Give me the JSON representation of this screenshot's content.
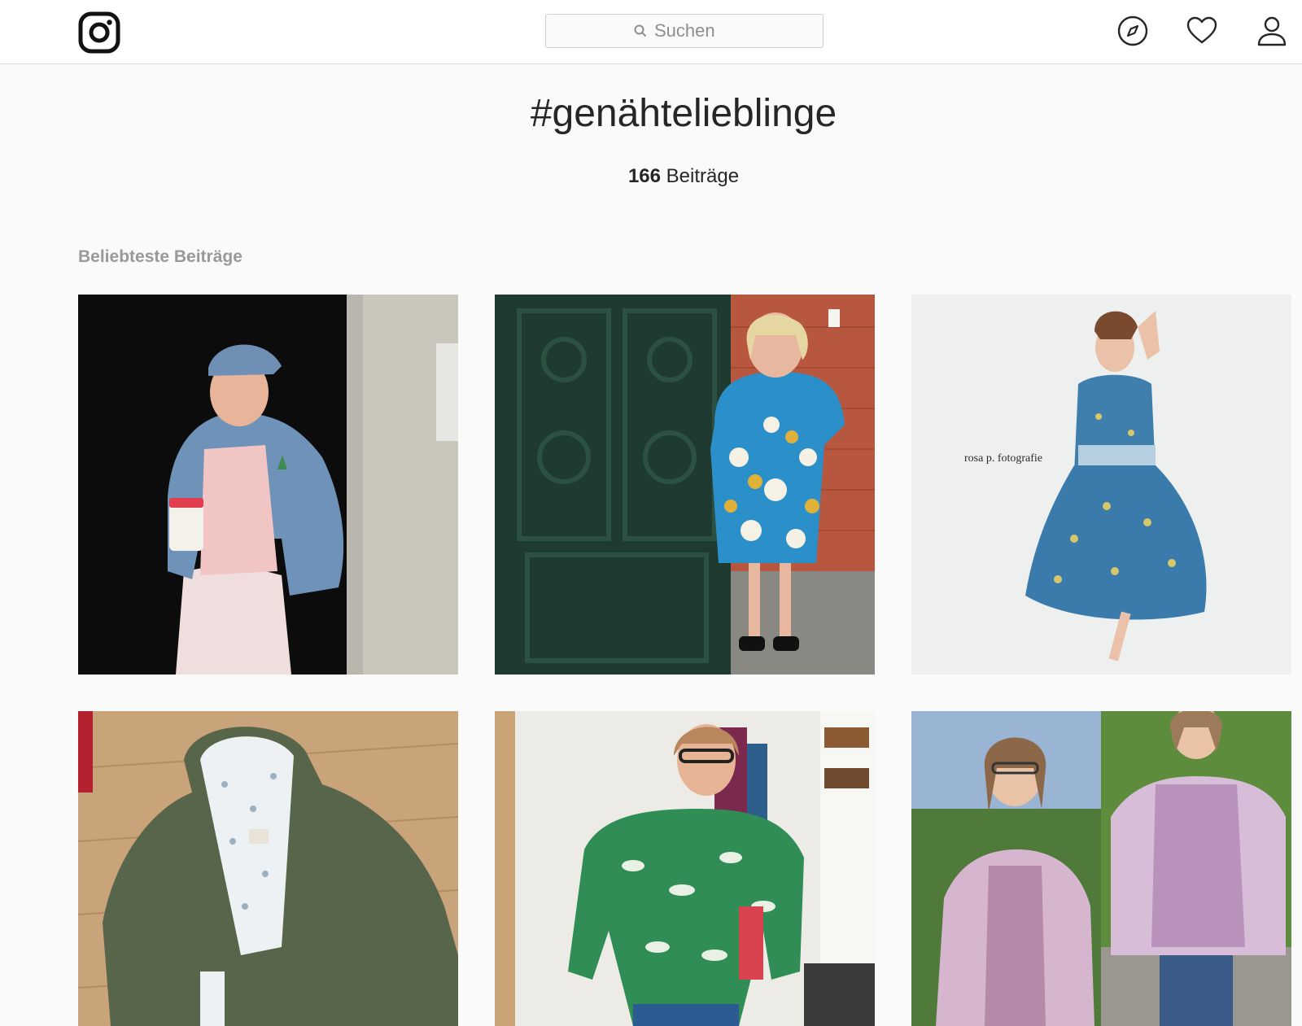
{
  "app": {
    "name": "Instagram"
  },
  "header": {
    "logo_icon": "instagram-logo-icon",
    "search": {
      "placeholder": "Suchen",
      "icon": "search-icon"
    },
    "nav": [
      {
        "name": "explore",
        "icon": "compass-icon"
      },
      {
        "name": "activity",
        "icon": "heart-icon"
      },
      {
        "name": "profile",
        "icon": "user-icon"
      }
    ]
  },
  "hashtag": {
    "title": "#genähtelieblinge",
    "post_count": "166",
    "post_count_label": "Beiträge"
  },
  "section": {
    "label": "Beliebteste Beiträge"
  },
  "posts": [
    {
      "description": "woman in denim jacket holding coffee cup"
    },
    {
      "description": "woman in blue patterned dress at iron gate"
    },
    {
      "description": "woman in blue floral dress",
      "watermark": "rosa p. fotografie"
    },
    {
      "description": "olive green rain jacket on wooden floor"
    },
    {
      "description": "woman in green leaf print sweater"
    },
    {
      "description": "woman in lilac coat and dress, two photos"
    }
  ]
}
